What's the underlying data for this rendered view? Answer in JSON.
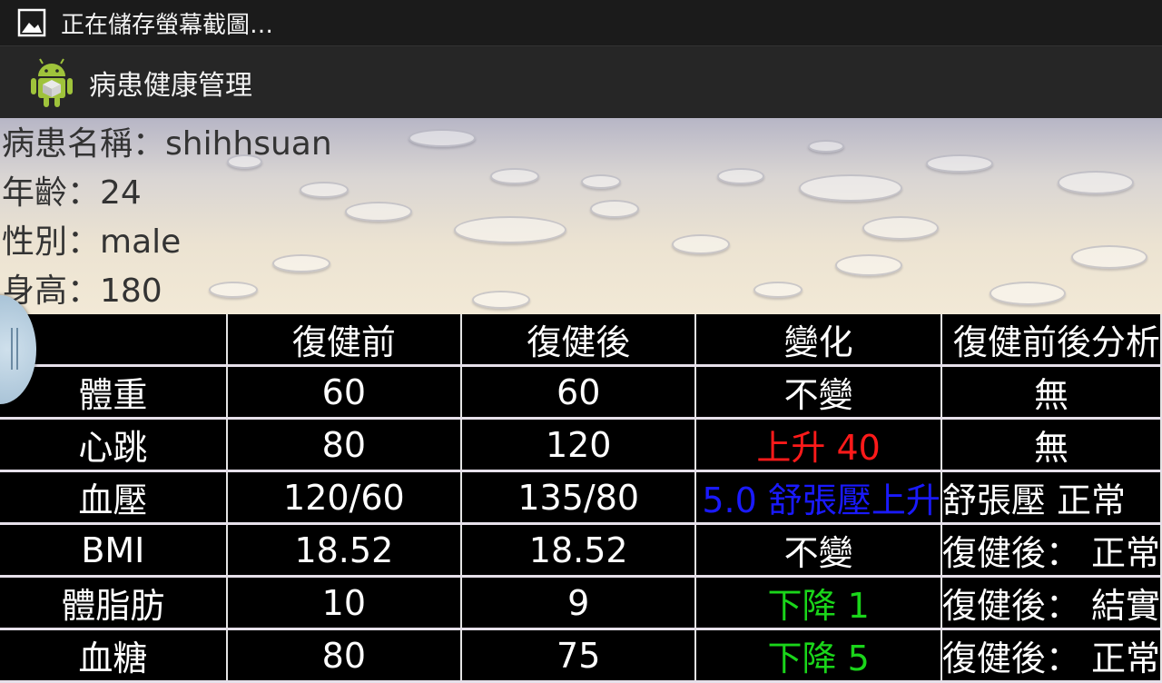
{
  "status": {
    "text": "正在儲存螢幕截圖…",
    "icon": "image-icon"
  },
  "app": {
    "title": "病患健康管理",
    "icon": "android-logo-icon"
  },
  "patient": {
    "name_line": "病患名稱：shihhsuan",
    "age_line": "年齡：24",
    "gender_line": "性別：male",
    "height_line": "身高：180"
  },
  "table": {
    "headers": [
      "",
      "復健前",
      "復健後",
      "變化",
      "復健前後分析"
    ],
    "rows": [
      {
        "label": "體重",
        "before": "60",
        "after": "60",
        "change": "不變",
        "analysis": "無"
      },
      {
        "label": "心跳",
        "before": "80",
        "after": "120",
        "change": "上升 40",
        "analysis": "無"
      },
      {
        "label": "血壓",
        "before": "120/60",
        "after": "135/80",
        "change": "5.0 舒張壓上升",
        "analysis": "舒張壓 正常"
      },
      {
        "label": "BMI",
        "before": "18.52",
        "after": "18.52",
        "change": "不變",
        "analysis": "復健後： 正常"
      },
      {
        "label": "體脂肪",
        "before": "10",
        "after": "9",
        "change": "下降 1",
        "analysis": "復健後： 結實"
      },
      {
        "label": "血糖",
        "before": "80",
        "after": "75",
        "change": "下降 5",
        "analysis": "復健後： 正常"
      }
    ]
  },
  "colors": {
    "rise": "#ff1a1a",
    "bp_change": "#1a1aff",
    "fall": "#1ad51a"
  }
}
